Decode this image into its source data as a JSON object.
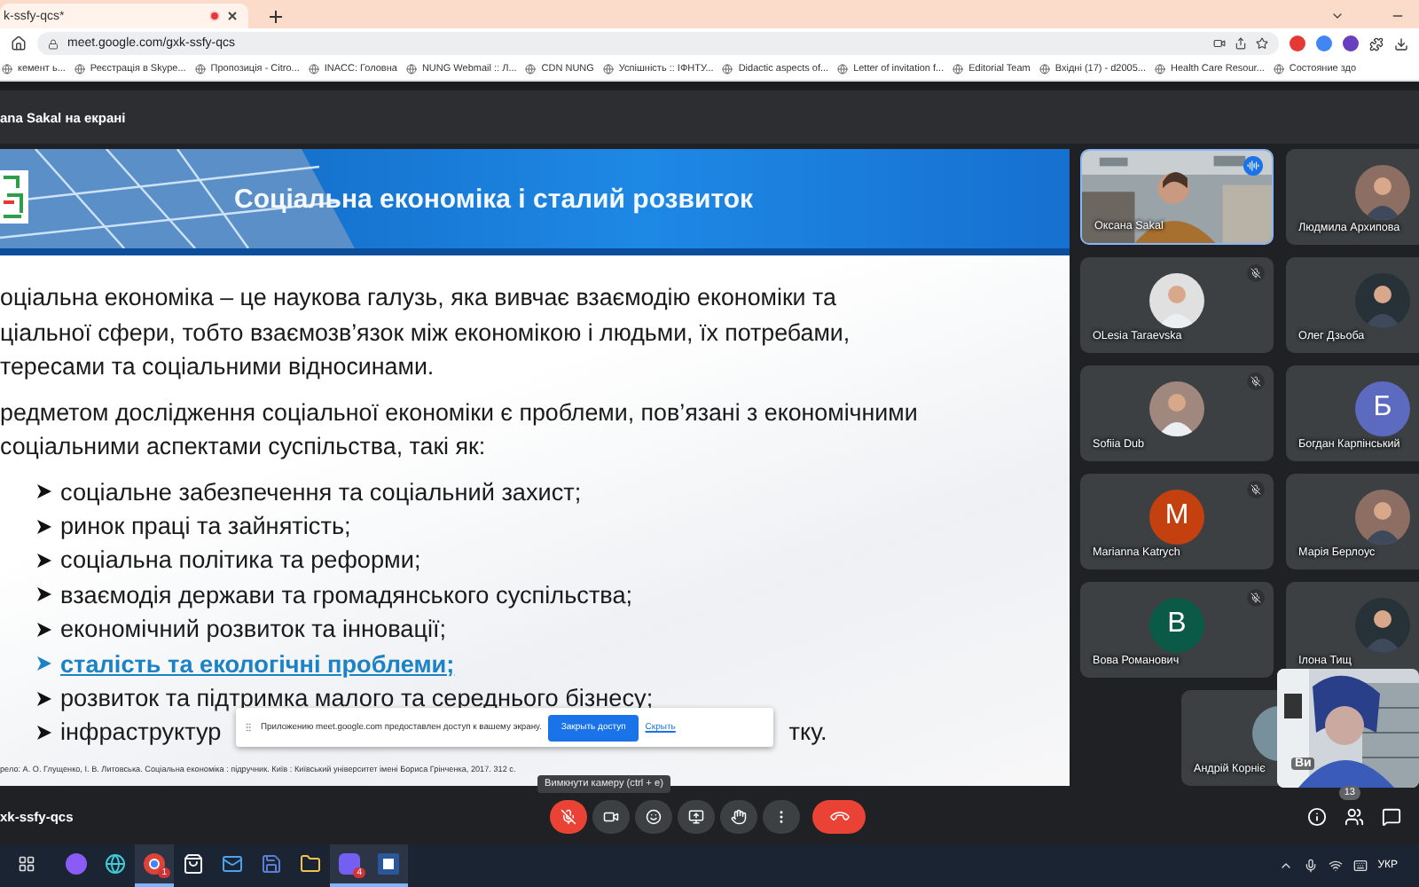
{
  "browser": {
    "tab": {
      "title": "k-ssfy-qcs*",
      "recording": true
    },
    "url": "meet.google.com/gxk-ssfy-qcs",
    "bookmarks": [
      "кемент ь...",
      "Реєстрація в Skype...",
      "Пропозиція - Citro...",
      "INACC: Головна",
      "NUNG Webmail :: Л...",
      "CDN NUNG",
      "Успішність :: ІФНТУ...",
      "Didactic aspects of...",
      "Letter of invitation f...",
      "Editorial Team",
      "Вхідні (17) - d2005...",
      "Health Care Resour...",
      "Состояние здо"
    ]
  },
  "meet": {
    "presenting_banner": "ana Sakal на екрані",
    "slide": {
      "title": "Соціальна економіка і сталий розвиток",
      "paragraphs": [
        [
          "оціальна економіка – це наукова галузь, яка вивчає взаємодію економіки та",
          "ціальної сфери, тобто взаємозв’язок між економікою і людьми, їх потребами,",
          "тересами та соціальними відносинами."
        ],
        [
          "редметом дослідження соціальної економіки є проблеми, пов’язані з економічними",
          "соціальними аспектами суспільства, такі як:"
        ]
      ],
      "bullets": [
        {
          "text": "соціальне забезпечення та соціальний захист;",
          "highlighted": false
        },
        {
          "text": "ринок праці та зайнятість;",
          "highlighted": false
        },
        {
          "text": "соціальна політика та реформи;",
          "highlighted": false
        },
        {
          "text": "взаємодія держави та громадянського суспільства;",
          "highlighted": false
        },
        {
          "text": "економічний розвиток та інновації;",
          "highlighted": false
        },
        {
          "text": "сталість та екологічні проблеми;",
          "highlighted": true
        },
        {
          "text": "розвиток та підтримка малого та середнього бізнесу;",
          "highlighted": false
        },
        {
          "text": "інфраструктур",
          "tail": "тку.",
          "highlighted": false
        }
      ],
      "footnote": "рело: А. О. Глущенко, І. В. Литовська. Соціальна економіка : підручник. Київ : Київський університет імені Бориса Грінченка, 2017. 312 с."
    },
    "share_notice": {
      "message": "Приложению meet.google.com предоставлен доступ к вашему экрану.",
      "stop_button": "Закрыть доступ",
      "hide_link": "Скрыть"
    },
    "tooltip": "Вимкнути камеру (ctrl + e)",
    "participants": [
      {
        "name": "Оксана Sakal",
        "kind": "video",
        "muted": false,
        "speaking": true
      },
      {
        "name": "Людмила Архипова",
        "speaking": false
      },
      {
        "name": "OLesia Taraevska",
        "muted": true,
        "speaking": false
      },
      {
        "name": "Олег Дзьоба",
        "speaking": false
      },
      {
        "name": "Sofiia Dub",
        "muted": true,
        "speaking": false
      },
      {
        "name": "Богдан Карпінський",
        "kind": "letter",
        "letter": "Б",
        "color": "#5c6bc0",
        "speaking": false
      },
      {
        "name": "Marianna Katrych",
        "kind": "letter",
        "letter": "M",
        "color": "#c5400f",
        "muted": true,
        "speaking": false
      },
      {
        "name": "Марія Берлоус",
        "speaking": false
      },
      {
        "name": "Вова Романович",
        "kind": "letter",
        "letter": "B",
        "color": "#0b5a48",
        "muted": true,
        "speaking": false
      },
      {
        "name": "Ілона Тищ",
        "speaking": false
      },
      {
        "name": "Андрій Корніє",
        "kind": "letter",
        "color": "#78909c",
        "speaking": false
      }
    ],
    "self_view": {
      "label": "Ви"
    },
    "meeting_code": "xk-ssfy-qcs",
    "controls": [
      {
        "kind": "mic",
        "on": false
      },
      {
        "kind": "camera",
        "on": true
      },
      {
        "kind": "reactions"
      },
      {
        "kind": "present"
      },
      {
        "kind": "raise_hand"
      },
      {
        "kind": "more"
      },
      {
        "kind": "leave"
      }
    ],
    "people_count": "13"
  },
  "taskbar": {
    "apps": [
      {
        "kind": "alice",
        "active": false
      },
      {
        "kind": "edge",
        "active": false
      },
      {
        "kind": "chrome",
        "badge": "1",
        "active": true
      },
      {
        "kind": "store",
        "active": false
      },
      {
        "kind": "mail",
        "active": false
      },
      {
        "kind": "save",
        "active": false
      },
      {
        "kind": "folder",
        "active": false
      },
      {
        "kind": "viber",
        "badge": "4",
        "active": true
      },
      {
        "kind": "word",
        "active": true
      }
    ],
    "language": "УКР"
  }
}
